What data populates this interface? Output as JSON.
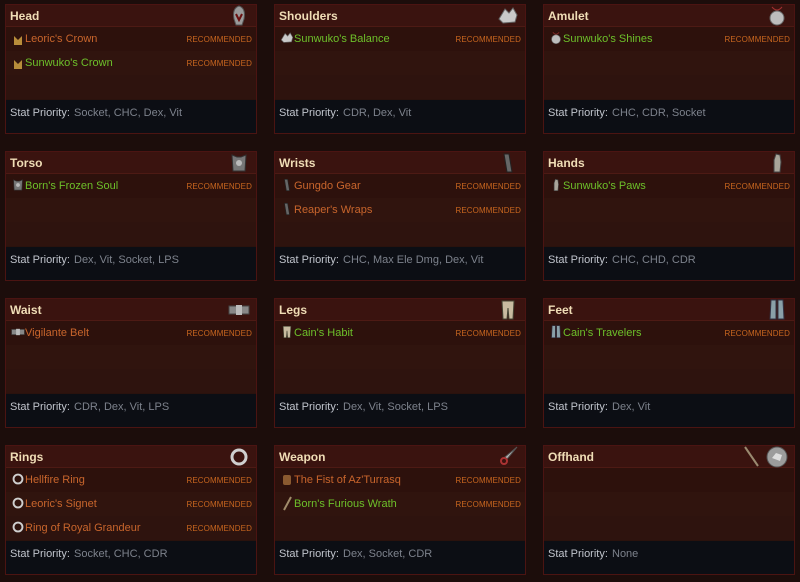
{
  "recommended_label": "RECOMMENDED",
  "stat_priority_label": "Stat Priority:",
  "colors": {
    "legendary": "#c8652c",
    "set": "#6dc02a",
    "recommended": "#c8661f",
    "title": "#f0ddb6"
  },
  "slots": [
    {
      "title": "Head",
      "icon": "helm-icon",
      "items": [
        {
          "name": "Leoric's Crown",
          "rarity": "legendary",
          "icon": "crown-icon",
          "tag": "RECOMMENDED"
        },
        {
          "name": "Sunwuko's Crown",
          "rarity": "set",
          "icon": "crown-icon",
          "tag": "RECOMMENDED"
        }
      ],
      "stat_priority": "Socket, CHC, Dex, Vit"
    },
    {
      "title": "Shoulders",
      "icon": "shoulders-icon",
      "items": [
        {
          "name": "Sunwuko's Balance",
          "rarity": "set",
          "icon": "shoulders-icon",
          "tag": "RECOMMENDED"
        }
      ],
      "stat_priority": "CDR, Dex, Vit"
    },
    {
      "title": "Amulet",
      "icon": "amulet-icon",
      "items": [
        {
          "name": "Sunwuko's Shines",
          "rarity": "set",
          "icon": "amulet-icon",
          "tag": "RECOMMENDED"
        }
      ],
      "stat_priority": "CHC, CDR, Socket"
    },
    {
      "title": "Torso",
      "icon": "chest-armor-icon",
      "items": [
        {
          "name": "Born's Frozen Soul",
          "rarity": "set",
          "icon": "chest-armor-icon",
          "tag": "RECOMMENDED"
        }
      ],
      "stat_priority": "Dex, Vit, Socket, LPS"
    },
    {
      "title": "Wrists",
      "icon": "bracers-icon",
      "items": [
        {
          "name": "Gungdo Gear",
          "rarity": "legendary",
          "icon": "bracers-icon",
          "tag": "RECOMMENDED"
        },
        {
          "name": "Reaper's Wraps",
          "rarity": "legendary",
          "icon": "bracers-icon",
          "tag": "RECOMMENDED"
        }
      ],
      "stat_priority": "CHC, Max Ele Dmg, Dex, Vit"
    },
    {
      "title": "Hands",
      "icon": "gloves-icon",
      "items": [
        {
          "name": "Sunwuko's Paws",
          "rarity": "set",
          "icon": "gloves-icon",
          "tag": "RECOMMENDED"
        }
      ],
      "stat_priority": "CHC, CHD, CDR"
    },
    {
      "title": "Waist",
      "icon": "belt-icon",
      "items": [
        {
          "name": "Vigilante Belt",
          "rarity": "legendary",
          "icon": "belt-icon",
          "tag": "RECOMMENDED"
        }
      ],
      "stat_priority": "CDR, Dex, Vit, LPS"
    },
    {
      "title": "Legs",
      "icon": "pants-icon",
      "items": [
        {
          "name": "Cain's Habit",
          "rarity": "set",
          "icon": "pants-icon",
          "tag": "RECOMMENDED"
        }
      ],
      "stat_priority": "Dex, Vit, Socket, LPS"
    },
    {
      "title": "Feet",
      "icon": "boots-icon",
      "items": [
        {
          "name": "Cain's Travelers",
          "rarity": "set",
          "icon": "boots-icon",
          "tag": "RECOMMENDED"
        }
      ],
      "stat_priority": "Dex, Vit"
    },
    {
      "title": "Rings",
      "icon": "ring-icon",
      "items": [
        {
          "name": "Hellfire Ring",
          "rarity": "legendary",
          "icon": "ring-icon",
          "tag": "RECOMMENDED"
        },
        {
          "name": "Leoric's Signet",
          "rarity": "legendary",
          "icon": "ring-icon",
          "tag": "RECOMMENDED"
        },
        {
          "name": "Ring of Royal Grandeur",
          "rarity": "legendary",
          "icon": "ring-icon",
          "tag": "RECOMMENDED"
        }
      ],
      "stat_priority": "Socket, CHC, CDR"
    },
    {
      "title": "Weapon",
      "icon": "dagger-icon",
      "items": [
        {
          "name": "The Fist of Az'Turrasq",
          "rarity": "legendary",
          "icon": "fist-weapon-icon",
          "tag": "RECOMMENDED"
        },
        {
          "name": "Born's Furious Wrath",
          "rarity": "set",
          "icon": "sword-icon",
          "tag": "RECOMMENDED"
        }
      ],
      "stat_priority": "Dex, Socket, CDR"
    },
    {
      "title": "Offhand",
      "icon": "shield-icon",
      "items": [],
      "stat_priority": "None"
    }
  ]
}
